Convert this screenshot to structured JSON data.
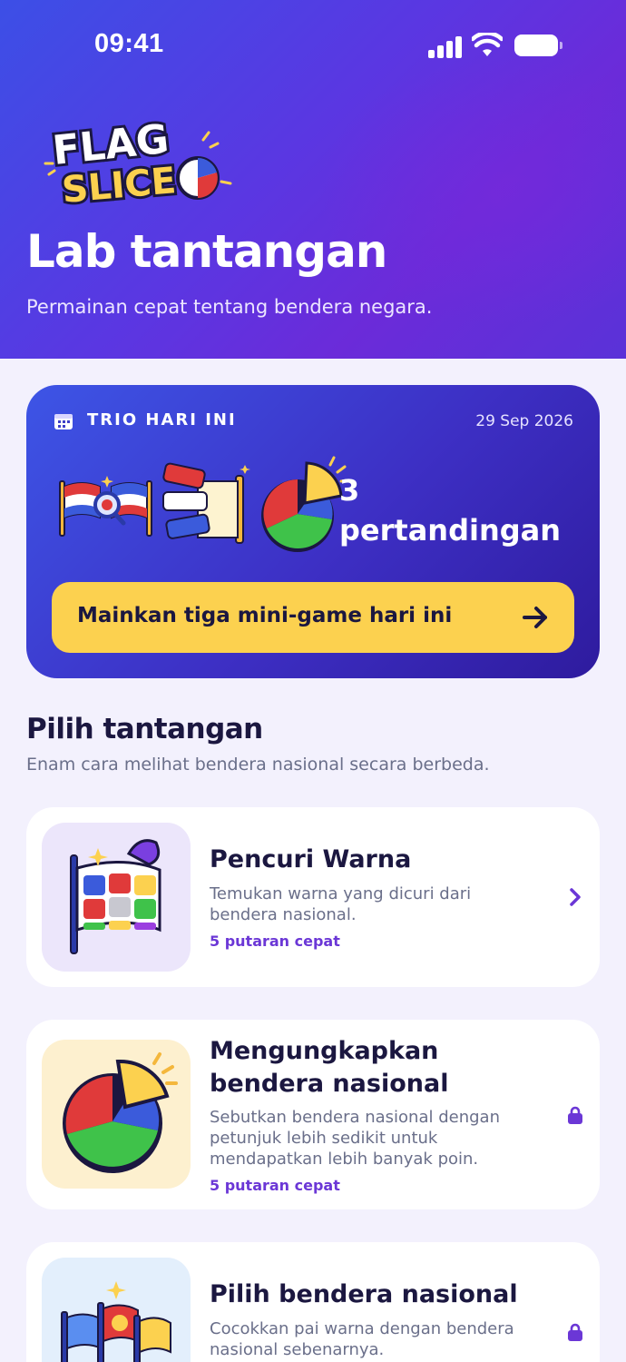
{
  "status_bar": {
    "time": "09:41"
  },
  "header": {
    "logo_text": [
      "FLAG",
      "SLICE"
    ],
    "title": "Lab tantangan",
    "subtitle": "Permainan cepat tentang bendera negara."
  },
  "daily": {
    "label": "TRIO HARI INI",
    "date": "29 Sep 2026",
    "count": "3",
    "count_unit": "pertandingan",
    "button_label": "Mainkan tiga mini-game hari ini"
  },
  "section": {
    "title": "Pilih tantangan",
    "subtitle": "Enam cara melihat bendera nasional secara berbeda."
  },
  "challenges": [
    {
      "title": "Pencuri Warna",
      "description": "Temukan warna yang dicuri dari bendera nasional.",
      "meta": "5 putaran cepat",
      "status_icon": "chevron-right-icon",
      "thumb_color": "#ece6fb"
    },
    {
      "title": "Mengungkapkan bendera nasional",
      "description": "Sebutkan bendera nasional dengan petunjuk lebih sedikit untuk mendapatkan lebih banyak poin.",
      "meta": "5 putaran cepat",
      "status_icon": "lock-icon",
      "thumb_color": "#fdf0cf"
    },
    {
      "title": "Pilih bendera nasional",
      "description": "Cocokkan pai warna dengan bendera nasional sebenarnya.",
      "meta": "",
      "status_icon": "lock-icon",
      "thumb_color": "#e3effc"
    }
  ],
  "colors": {
    "accent": "#6b37d6",
    "button_yellow": "#fcd14f",
    "text_dark": "#1b1740",
    "text_muted": "#6a6f8a"
  }
}
